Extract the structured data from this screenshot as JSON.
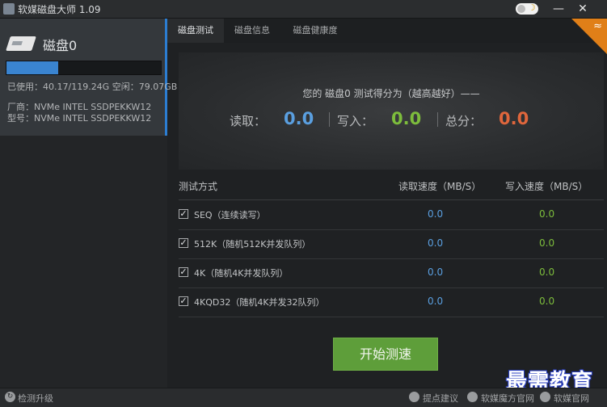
{
  "window": {
    "title": "软媒磁盘大师 1.09",
    "min_label": "—",
    "close_label": "✕",
    "moon_icon": "☽"
  },
  "disk": {
    "name": "磁盘0",
    "usage_fraction": 0.337,
    "usage_text": "已使用：40.17/119.24G 空闲：79.07GB",
    "vendor": "厂商：NVMe INTEL SSDPEKKW12",
    "model": "型号：NVMe INTEL SSDPEKKW12"
  },
  "tabs": [
    {
      "label": "磁盘测试",
      "active": true
    },
    {
      "label": "磁盘信息",
      "active": false
    },
    {
      "label": "磁盘健康度",
      "active": false
    }
  ],
  "corner_icon": "≈",
  "score": {
    "caption": "您的 磁盘0 测试得分为（越高越好）——",
    "read_label": "读取：",
    "read_value": "0.0",
    "write_label": "写入：",
    "write_value": "0.0",
    "total_label": "总分：",
    "total_value": "0.0",
    "colors": {
      "read": "#5a9fe0",
      "write": "#7dbd3c",
      "total": "#e0663c"
    }
  },
  "table": {
    "headers": {
      "mode": "测试方式",
      "read": "读取速度（MB/S）",
      "write": "写入速度（MB/S）"
    },
    "rows": [
      {
        "mode": "SEQ（连续读写）",
        "read": "0.0",
        "write": "0.0"
      },
      {
        "mode": "512K（随机512K并发队列）",
        "read": "0.0",
        "write": "0.0"
      },
      {
        "mode": "4K（随机4K并发队列）",
        "read": "0.0",
        "write": "0.0"
      },
      {
        "mode": "4KQD32（随机4K并发32队列）",
        "read": "0.0",
        "write": "0.0"
      }
    ],
    "check_glyph": "✓"
  },
  "start_button": "开始测速",
  "statusbar": {
    "update_icon": "↻",
    "update": "检测升级",
    "suggest": "提点建议",
    "mofang": "软媒魔方官网",
    "official": "软媒官网"
  },
  "watermark": "最需教育"
}
